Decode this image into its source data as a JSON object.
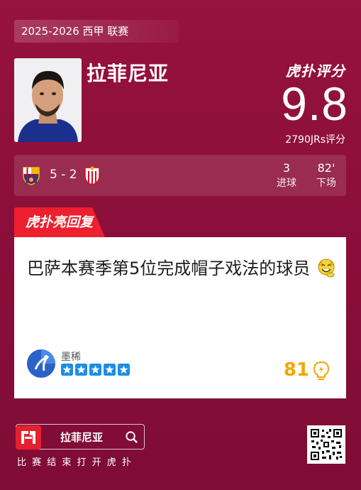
{
  "header": {
    "season": "2025-2026 西甲 联赛"
  },
  "player": {
    "name": "拉菲尼亚"
  },
  "rating": {
    "brand_label": "虎扑评分",
    "score": "9.8",
    "count_label": "2790JRs评分"
  },
  "match": {
    "home_team": "Barcelona",
    "away_team": "Sevilla",
    "score": "5 - 2",
    "stats": [
      {
        "value": "3",
        "label": "进球"
      },
      {
        "value": "82'",
        "label": "下场"
      }
    ]
  },
  "highlight": {
    "tab_label": "虎扑亮回复",
    "reply_text": "巴萨本赛季第5位完成帽子戏法的球员",
    "emoji": "grinning-cat-emoji",
    "user_name": "墨稀",
    "stars": 5,
    "likes": "81"
  },
  "footer": {
    "search_text": "拉菲尼亚",
    "tagline": "比 赛 结 束   打 开 虎 扑"
  },
  "colors": {
    "background": "#8c0f3a",
    "accent_red": "#ee1f2e",
    "star_blue": "#1a8fe3",
    "likes_gold": "#f0a800"
  }
}
